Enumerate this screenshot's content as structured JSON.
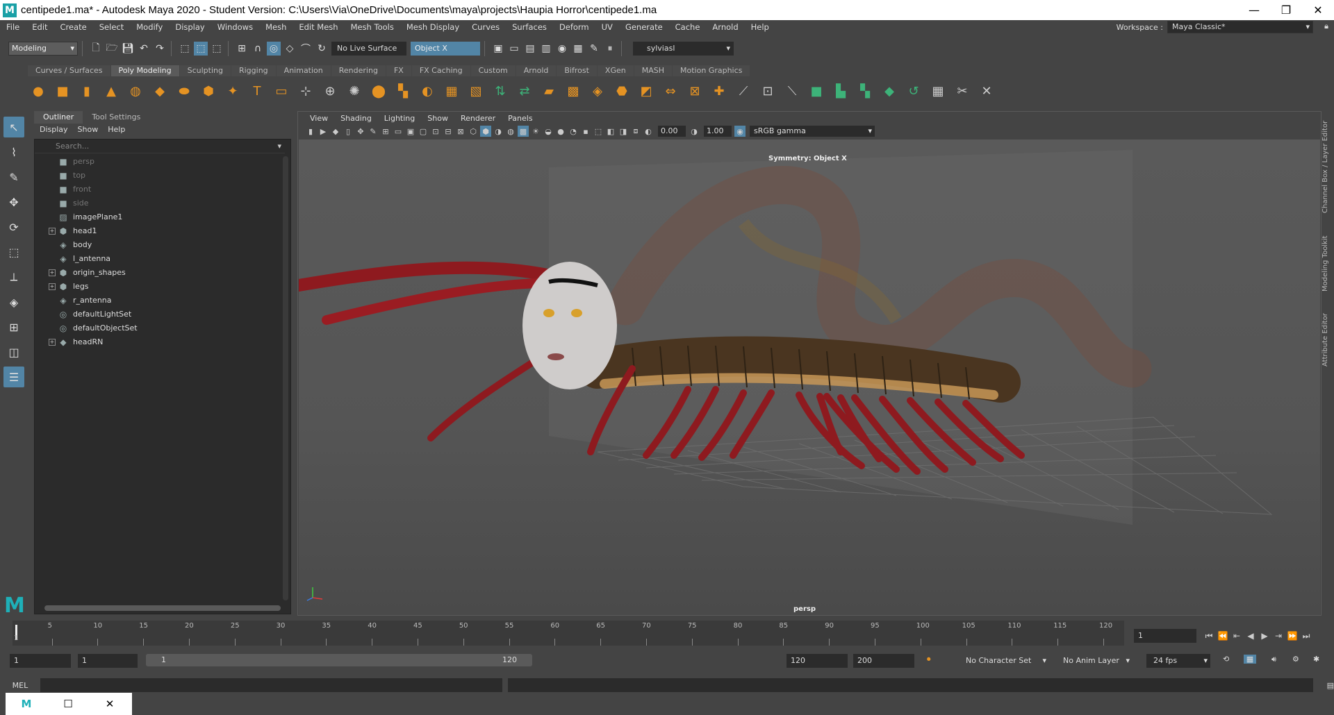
{
  "window": {
    "title": "centipede1.ma* - Autodesk Maya 2020 - Student Version: C:\\Users\\Via\\OneDrive\\Documents\\maya\\projects\\Haupia Horror\\centipede1.ma",
    "minimize": "—",
    "maximize": "❐",
    "close": "✕"
  },
  "menubar": {
    "items": [
      "File",
      "Edit",
      "Create",
      "Select",
      "Modify",
      "Display",
      "Windows",
      "Mesh",
      "Edit Mesh",
      "Mesh Tools",
      "Mesh Display",
      "Curves",
      "Surfaces",
      "Deform",
      "UV",
      "Generate",
      "Cache",
      "Arnold",
      "Help"
    ],
    "workspace_label": "Workspace :",
    "workspace_value": "Maya Classic*"
  },
  "statusline": {
    "mode": "Modeling",
    "live_surface": "No Live Surface",
    "symmetry": "Object X",
    "user": "sylviasl"
  },
  "shelf": {
    "tabs": [
      "Curves / Surfaces",
      "Poly Modeling",
      "Sculpting",
      "Rigging",
      "Animation",
      "Rendering",
      "FX",
      "FX Caching",
      "Custom",
      "Arnold",
      "Bifrost",
      "XGen",
      "MASH",
      "Motion Graphics"
    ],
    "active_tab": "Poly Modeling"
  },
  "outliner": {
    "tabs": [
      "Outliner",
      "Tool Settings"
    ],
    "menu": [
      "Display",
      "Show",
      "Help"
    ],
    "search_placeholder": "Search...",
    "items": [
      {
        "label": "persp",
        "icon": "camera-icon",
        "dim": true,
        "expand": false
      },
      {
        "label": "top",
        "icon": "camera-icon",
        "dim": true,
        "expand": false
      },
      {
        "label": "front",
        "icon": "camera-icon",
        "dim": true,
        "expand": false
      },
      {
        "label": "side",
        "icon": "camera-icon",
        "dim": true,
        "expand": false
      },
      {
        "label": "imagePlane1",
        "icon": "image-plane-icon",
        "dim": false,
        "expand": false
      },
      {
        "label": "head1",
        "icon": "group-icon",
        "dim": false,
        "expand": true
      },
      {
        "label": "body",
        "icon": "mesh-icon",
        "dim": false,
        "expand": false
      },
      {
        "label": "l_antenna",
        "icon": "mesh-icon",
        "dim": false,
        "expand": false
      },
      {
        "label": "origin_shapes",
        "icon": "group-icon",
        "dim": false,
        "expand": true
      },
      {
        "label": "legs",
        "icon": "group-icon",
        "dim": false,
        "expand": true
      },
      {
        "label": "r_antenna",
        "icon": "mesh-icon",
        "dim": false,
        "expand": false
      },
      {
        "label": "defaultLightSet",
        "icon": "set-icon",
        "dim": false,
        "expand": false
      },
      {
        "label": "defaultObjectSet",
        "icon": "set-icon",
        "dim": false,
        "expand": false
      },
      {
        "label": "headRN",
        "icon": "reference-icon",
        "dim": false,
        "expand": true
      }
    ]
  },
  "viewport": {
    "menu": [
      "View",
      "Shading",
      "Lighting",
      "Show",
      "Renderer",
      "Panels"
    ],
    "exposure": "0.00",
    "gamma": "1.00",
    "color_space": "sRGB gamma",
    "symmetry_label": "Symmetry: Object X",
    "camera_label": "persp"
  },
  "side_tabs": [
    "Channel Box / Layer Editor",
    "Modeling Toolkit",
    "Attribute Editor"
  ],
  "timeline": {
    "ticks": [
      "5",
      "10",
      "15",
      "20",
      "25",
      "30",
      "35",
      "40",
      "45",
      "50",
      "55",
      "60",
      "65",
      "70",
      "75",
      "80",
      "85",
      "90",
      "95",
      "100",
      "105",
      "110",
      "115",
      "120"
    ],
    "current_frame": "1",
    "current_marker": "1"
  },
  "range": {
    "start": "1",
    "playback_start": "1",
    "slider_start": "1",
    "slider_end": "120",
    "playback_end": "120",
    "end": "200",
    "character_set": "No Character Set",
    "anim_layer": "No Anim Layer",
    "fps": "24 fps"
  },
  "cmdline": {
    "label": "MEL"
  }
}
